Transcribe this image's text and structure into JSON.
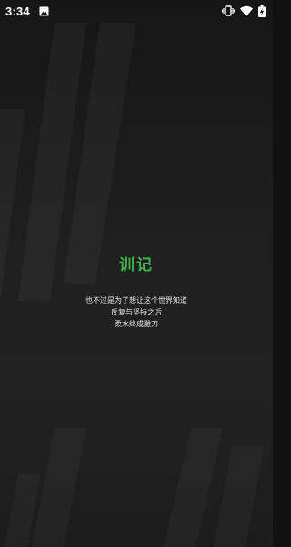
{
  "status_bar": {
    "time": "3:34",
    "icons": [
      "image-icon",
      "vibrate-icon",
      "wifi-icon",
      "battery-charging-icon"
    ]
  },
  "splash": {
    "title": "训记",
    "lines": [
      "也不过是为了想让这个世界知道",
      "反复与坚持之后",
      "柔水终成雕刀"
    ]
  },
  "colors": {
    "accent": "#3fb24a",
    "background": "#1e1e1e",
    "text": "#e9e9e9"
  }
}
